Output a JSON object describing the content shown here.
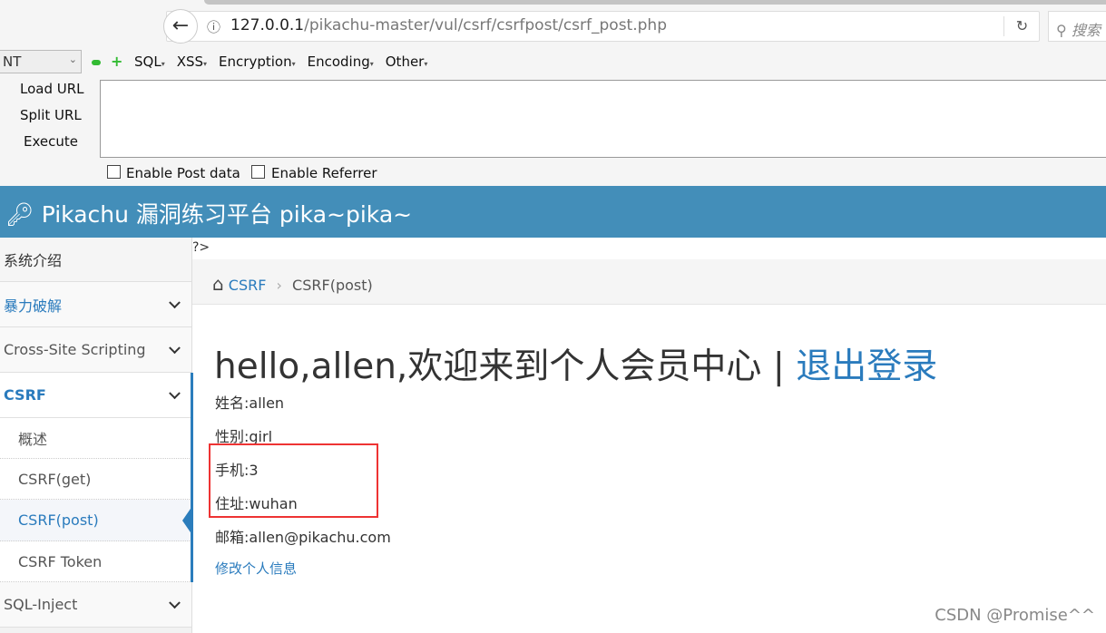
{
  "browser": {
    "url_host": "127.0.0.1",
    "url_path": "/pikachu-master/vul/csrf/csrfpost/csrf_post.php",
    "search_placeholder": "搜索"
  },
  "hackbar": {
    "select_value": "NT",
    "menus": [
      "SQL",
      "XSS",
      "Encryption",
      "Encoding",
      "Other"
    ],
    "load_url": "Load URL",
    "split_url": "Split URL",
    "execute": "Execute",
    "enable_post": "Enable Post data",
    "enable_referrer": "Enable Referrer"
  },
  "header": {
    "title": "Pikachu 漏洞练习平台 pika~pika~"
  },
  "sidebar": {
    "items": [
      {
        "label": "系统介绍"
      },
      {
        "label": "暴力破解"
      },
      {
        "label": "Cross-Site Scripting"
      },
      {
        "label": "CSRF"
      },
      {
        "label": "概述"
      },
      {
        "label": "CSRF(get)"
      },
      {
        "label": "CSRF(post)"
      },
      {
        "label": "CSRF Token"
      },
      {
        "label": "SQL-Inject"
      }
    ]
  },
  "content": {
    "stray": "?>",
    "breadcrumb": {
      "parent": "CSRF",
      "current": "CSRF(post)"
    },
    "heading": "hello,allen,欢迎来到个人会员中心 | ",
    "logout": "退出登录",
    "fields": [
      "姓名:allen",
      "性别:girl",
      "手机:3",
      "住址:wuhan",
      "邮箱:allen@pikachu.com"
    ],
    "edit_link": "修改个人信息"
  },
  "watermark": "CSDN @Promise^^",
  "colors": {
    "header": "#438eb9",
    "accent": "#2a7bbd",
    "highlight_box": "#ee3333"
  }
}
